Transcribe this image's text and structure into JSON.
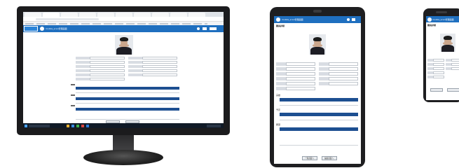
{
  "app": {
    "title": "mobile_scan管理画面",
    "section_title": "職員詳細"
  },
  "colors": {
    "header": "#1f6fbf",
    "table_header": "#1d4f91",
    "device_frame": "#1e1e20"
  },
  "icons": [
    "app-logo-icon",
    "user-icon",
    "bell-icon",
    "menu-icon",
    "windows-start-icon"
  ],
  "tablet": {
    "sections": [
      "実績",
      "予定",
      "履歴"
    ],
    "buttons": [
      "一覧画面へ",
      "編集画面へ"
    ]
  }
}
